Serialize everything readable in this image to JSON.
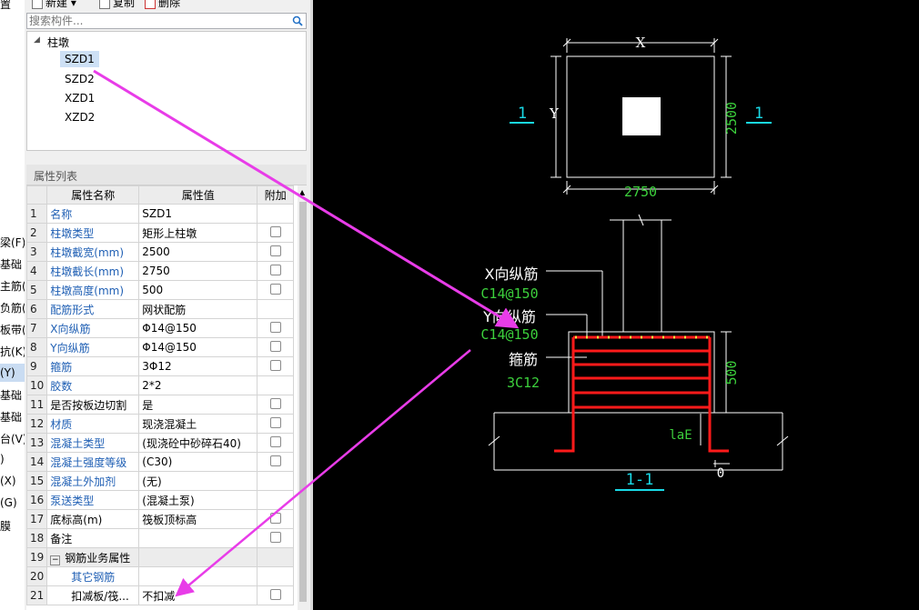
{
  "left_strip": [
    "置",
    "梁(F)",
    "基础",
    "主筋(",
    "负筋(",
    "板带(",
    "抗(K)",
    "(Y)",
    "基础",
    "基础",
    "台(V)",
    ")",
    "(X)",
    "(G)",
    "膜"
  ],
  "toolbar": {
    "new_label": "新建",
    "copy_label": "复制",
    "delete_label": "删除"
  },
  "search": {
    "placeholder": "搜索构件..."
  },
  "tree": {
    "root": "柱墩",
    "items": [
      {
        "label": "SZD1",
        "selected": true
      },
      {
        "label": "SZD2",
        "selected": false
      },
      {
        "label": "XZD1",
        "selected": false
      },
      {
        "label": "XZD2",
        "selected": false
      }
    ]
  },
  "properties": {
    "title": "属性列表",
    "columns": [
      "属性名称",
      "属性值",
      "附加"
    ],
    "rows": [
      {
        "num": "1",
        "name": "名称",
        "value": "SZD1",
        "blue": true,
        "checkbox": false
      },
      {
        "num": "2",
        "name": "柱墩类型",
        "value": "矩形上柱墩",
        "blue": true,
        "checkbox": true
      },
      {
        "num": "3",
        "name": "柱墩截宽(mm)",
        "value": "2500",
        "blue": true,
        "checkbox": true
      },
      {
        "num": "4",
        "name": "柱墩截长(mm)",
        "value": "2750",
        "blue": true,
        "checkbox": true
      },
      {
        "num": "5",
        "name": "柱墩高度(mm)",
        "value": "500",
        "blue": true,
        "checkbox": true
      },
      {
        "num": "6",
        "name": "配筋形式",
        "value": "网状配筋",
        "blue": true,
        "checkbox": false
      },
      {
        "num": "7",
        "name": "X向纵筋",
        "value": "Φ14@150",
        "blue": true,
        "checkbox": true
      },
      {
        "num": "8",
        "name": "Y向纵筋",
        "value": "Φ14@150",
        "blue": true,
        "checkbox": true
      },
      {
        "num": "9",
        "name": "箍筋",
        "value": "3Φ12",
        "blue": true,
        "checkbox": true
      },
      {
        "num": "10",
        "name": "胶数",
        "value": "2*2",
        "blue": true,
        "checkbox": false
      },
      {
        "num": "11",
        "name": "是否按板边切割",
        "value": "是",
        "blue": false,
        "checkbox": true
      },
      {
        "num": "12",
        "name": "材质",
        "value": "现浇混凝土",
        "blue": true,
        "checkbox": true
      },
      {
        "num": "13",
        "name": "混凝土类型",
        "value": "(现浇砼中砂碎石40)",
        "blue": true,
        "checkbox": true
      },
      {
        "num": "14",
        "name": "混凝土强度等级",
        "value": "(C30)",
        "blue": true,
        "checkbox": true
      },
      {
        "num": "15",
        "name": "混凝土外加剂",
        "value": "(无)",
        "blue": true,
        "checkbox": false
      },
      {
        "num": "16",
        "name": "泵送类型",
        "value": "(混凝土泵)",
        "blue": true,
        "checkbox": false
      },
      {
        "num": "17",
        "name": "底标高(m)",
        "value": "筏板顶标高",
        "blue": false,
        "checkbox": true
      },
      {
        "num": "18",
        "name": "备注",
        "value": "",
        "blue": false,
        "checkbox": true
      },
      {
        "num": "19",
        "name": "钢筋业务属性",
        "value": "",
        "blue": false,
        "checkbox": false,
        "group": true
      },
      {
        "num": "20",
        "name": "其它钢筋",
        "value": "",
        "blue": true,
        "checkbox": false,
        "indent": true
      },
      {
        "num": "21",
        "name": "扣减板/筏...",
        "value": "不扣减",
        "blue": false,
        "checkbox": true,
        "indent": true
      }
    ]
  },
  "cad": {
    "plan": {
      "x_label": "X",
      "y_label": "Y",
      "dim_width": "2750",
      "dim_height": "2500",
      "section_mark": "1"
    },
    "section": {
      "x_rebar_label": "X向纵筋",
      "x_rebar_value": "C14@150",
      "y_rebar_label": "Y向纵筋",
      "y_rebar_value": "C14@150",
      "stirrup_label": "箍筋",
      "stirrup_value": "3C12",
      "dim_height": "500",
      "anchor_label": "laE",
      "cover": "0",
      "title": "1-1"
    }
  },
  "colors": {
    "arrow": "#e83ce8",
    "rebar": "#ff1a1a",
    "dim_green": "#3cd03c",
    "cyan": "#19d9e6"
  }
}
